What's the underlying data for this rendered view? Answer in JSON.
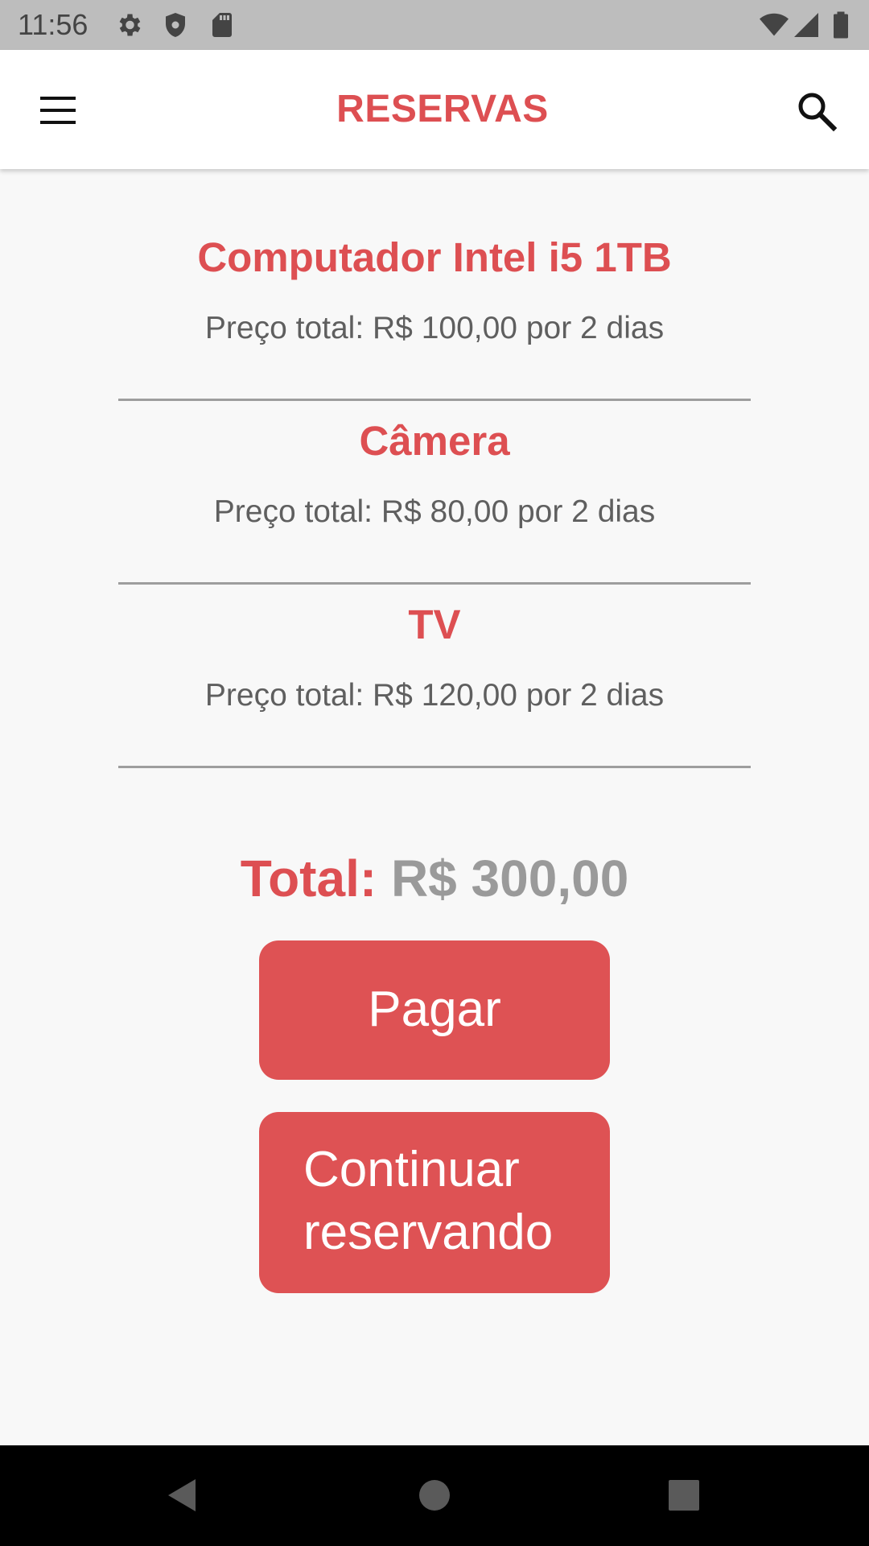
{
  "status_bar": {
    "time": "11:56",
    "icons": [
      "settings-icon",
      "shield-icon",
      "sd-card-icon",
      "wifi-icon",
      "signal-icon",
      "battery-icon"
    ]
  },
  "app_bar": {
    "title": "RESERVAS",
    "title_color": "#dd4f52",
    "menu_icon": "menu-icon",
    "search_icon": "search-icon"
  },
  "reservations": [
    {
      "name": "Computador Intel i5 1TB",
      "price": "Preço total: R$ 100,00 por 2 dias"
    },
    {
      "name": "Câmera",
      "price": "Preço total: R$ 80,00 por 2 dias"
    },
    {
      "name": "TV",
      "price": "Preço total: R$ 120,00 por 2 dias"
    }
  ],
  "total": {
    "label": "Total:",
    "value": "R$ 300,00"
  },
  "buttons": {
    "pay_label": "Pagar",
    "continue_label_line1": "Continuar",
    "continue_label_line2": "reservando",
    "color": "#de5254"
  },
  "nav_bar": {
    "icons": [
      "back-icon",
      "home-icon",
      "recents-icon"
    ]
  }
}
